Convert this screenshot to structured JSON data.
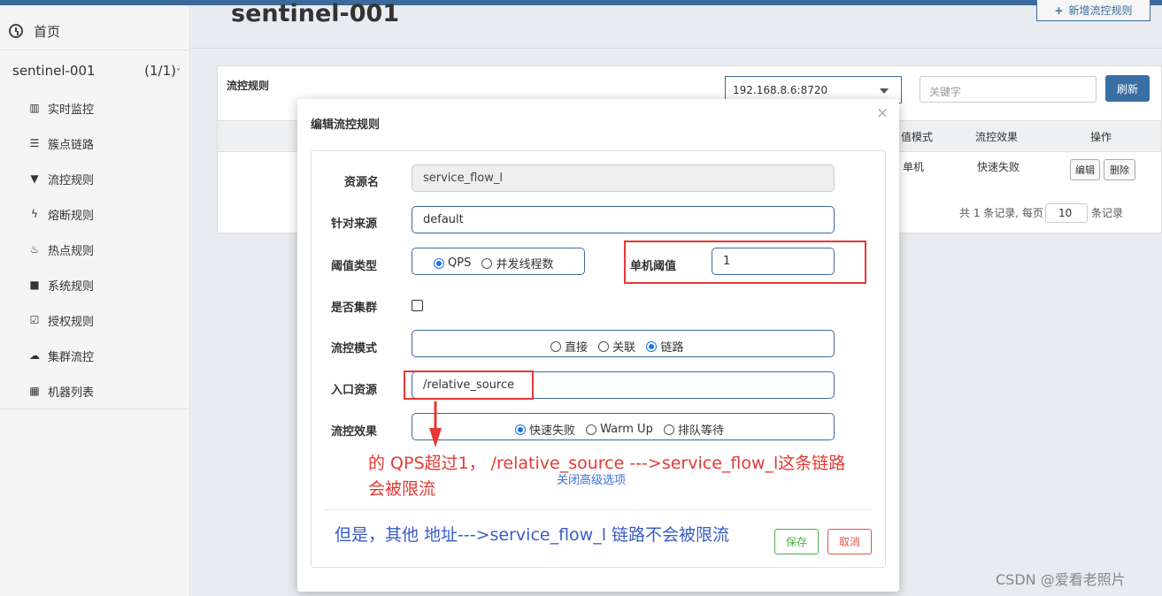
{
  "sidebar": {
    "home_label": "首页",
    "app_name": "sentinel-001",
    "app_count": "(1/1)",
    "menu": [
      {
        "label": "实时监控",
        "icon": "bar-chart-icon"
      },
      {
        "label": "簇点链路",
        "icon": "list-icon"
      },
      {
        "label": "流控规则",
        "icon": "filter-icon"
      },
      {
        "label": "熔断规则",
        "icon": "flash-icon"
      },
      {
        "label": "热点规则",
        "icon": "fire-icon"
      },
      {
        "label": "系统规则",
        "icon": "lock-icon"
      },
      {
        "label": "授权规则",
        "icon": "check-icon"
      },
      {
        "label": "集群流控",
        "icon": "cloud-icon"
      },
      {
        "label": "机器列表",
        "icon": "grid-icon"
      }
    ]
  },
  "page": {
    "title": "sentinel-001",
    "add_button": "新增流控规则",
    "panel_title": "流控规则",
    "machine_select": "192.168.8.6:8720",
    "keyword_placeholder": "关键字",
    "refresh_button": "刷新",
    "table_headers": [
      "值模式",
      "流控效果",
      "操作"
    ],
    "row": {
      "mode": "单机",
      "effect": "快速失败"
    },
    "edit_button": "编辑",
    "delete_button": "删除",
    "pager_prefix": "共 1 条记录, 每页",
    "page_size": "10",
    "pager_suffix": "条记录"
  },
  "modal": {
    "title": "编辑流控规则",
    "close": "×",
    "resource_label": "资源名",
    "resource_value": "service_flow_l",
    "origin_label": "针对来源",
    "origin_value": "default",
    "threshold_type_label": "阈值类型",
    "threshold_type_options": [
      "QPS",
      "并发线程数"
    ],
    "threshold_type_selected": "QPS",
    "single_threshold_label": "单机阈值",
    "single_threshold_value": "1",
    "cluster_label": "是否集群",
    "flow_mode_label": "流控模式",
    "flow_mode_options": [
      "直接",
      "关联",
      "链路"
    ],
    "flow_mode_selected": "链路",
    "entry_resource_label": "入口资源",
    "entry_resource_value": "/relative_source",
    "flow_effect_label": "流控效果",
    "flow_effect_options": [
      "快速失败",
      "Warm Up",
      "排队等待"
    ],
    "flow_effect_selected": "快速失败",
    "advanced_link": "关闭高级选项",
    "save_button": "保存",
    "cancel_button": "取消"
  },
  "annotations": {
    "red_line1": "的 QPS超过1， /relative_source  --->service_flow_l这条链路",
    "red_line2": "会被限流",
    "blue_line": "但是，其他 地址--->service_flow_l 链路不会被限流"
  },
  "watermark": "CSDN @爱看老照片",
  "colors": {
    "accent": "#3c6a9a",
    "annotation_red": "#e53935",
    "annotation_blue": "#3a5cc8"
  }
}
